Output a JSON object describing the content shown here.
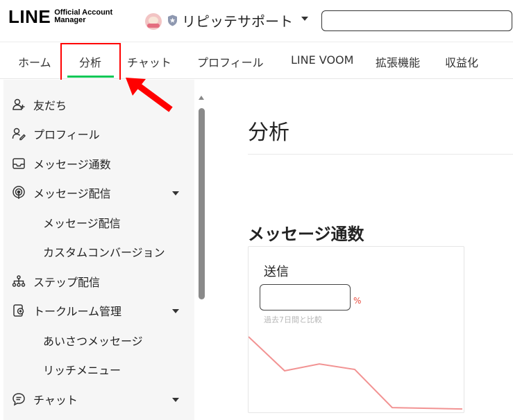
{
  "header": {
    "logo_text": "LINE",
    "logo_sub_line1": "Official Account",
    "logo_sub_line2": "Manager",
    "account_name": "リピッテサポート",
    "search_value": "",
    "search_placeholder": ""
  },
  "topnav": {
    "tabs": [
      {
        "label": "ホーム"
      },
      {
        "label": "分析"
      },
      {
        "label": "チャット"
      },
      {
        "label": "プロフィール"
      },
      {
        "label": "LINE VOOM"
      },
      {
        "label": "拡張機能"
      },
      {
        "label": "収益化"
      }
    ],
    "active_tab": "分析"
  },
  "sidebar": {
    "items": [
      {
        "label": "友だち",
        "icon": "friend-add-icon"
      },
      {
        "label": "プロフィール",
        "icon": "profile-edit-icon"
      },
      {
        "label": "メッセージ通数",
        "icon": "inbox-icon"
      },
      {
        "label": "メッセージ配信",
        "icon": "broadcast-icon",
        "expanded": true
      },
      {
        "label": "メッセージ配信",
        "sub": true
      },
      {
        "label": "カスタムコンバージョン",
        "sub": true
      },
      {
        "label": "ステップ配信",
        "icon": "step-tree-icon"
      },
      {
        "label": "トークルーム管理",
        "icon": "talkroom-icon",
        "expanded": true
      },
      {
        "label": "あいさつメッセージ",
        "sub": true
      },
      {
        "label": "リッチメニュー",
        "sub": true
      },
      {
        "label": "チャット",
        "icon": "chat-bubble-icon",
        "expanded": true
      }
    ]
  },
  "main": {
    "page_title": "分析",
    "section_title": "メッセージ通数",
    "card": {
      "label": "送信",
      "input_value": "",
      "percent_sign": "%",
      "compare_text": "過去7日間と比較"
    }
  },
  "chart_data": {
    "type": "line",
    "series": [
      {
        "values": [
          5.5,
          3.0,
          3.5,
          3.1,
          0.3,
          0.2
        ]
      }
    ],
    "color": "#f29393"
  },
  "colors": {
    "accent_green": "#06c755",
    "highlight_red": "#ff0000",
    "percent_red": "#e8483a",
    "chart_line": "#f29393",
    "sidebar_bg": "#f6f6f6"
  }
}
